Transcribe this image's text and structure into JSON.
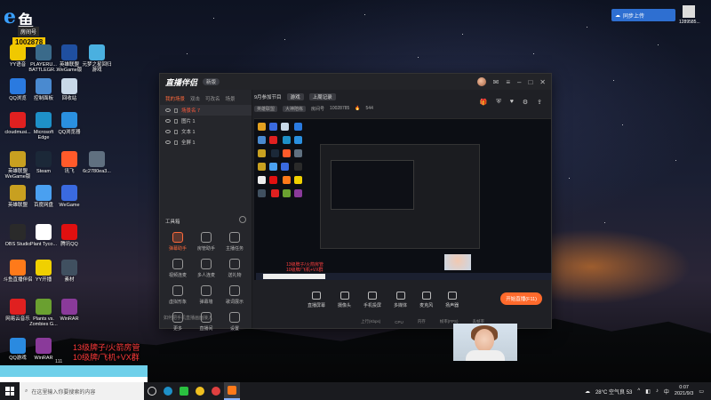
{
  "badge": {
    "room_label": "房间号",
    "room_number": "1002878"
  },
  "desktop_icons": [
    {
      "id": "yy",
      "label": "YY语音",
      "color": "#f0c800"
    },
    {
      "id": "playerunknown",
      "label": "PLAYERU... BATTLEGR...",
      "color": "#3a6a8a"
    },
    {
      "id": "lol-wegame",
      "label": "英雄联盟 WeGame版",
      "color": "#1f4fa0"
    },
    {
      "id": "yuanshen",
      "label": "元梦之星回归游戏",
      "color": "#4ab0e0"
    },
    {
      "id": "qq-browser",
      "label": "QQ浏览",
      "color": "#2a7ae0"
    },
    {
      "id": "control-panel",
      "label": "控制面板",
      "color": "#4a8ad0"
    },
    {
      "id": "recycle",
      "label": "回收站",
      "color": "#c8d8e8"
    },
    {
      "id": "cloudmusic",
      "label": "cloudmusi...",
      "color": "#e02020"
    },
    {
      "id": "edge",
      "label": "Microsoft Edge",
      "color": "#1e90c8"
    },
    {
      "id": "qqbrowser2",
      "label": "QQ浏览器",
      "color": "#2a90e0"
    },
    {
      "id": "lol-wegame2",
      "label": "英雄联盟 WeGame版",
      "color": "#c8a020"
    },
    {
      "id": "steam",
      "label": "Steam",
      "color": "#1b2838"
    },
    {
      "id": "xundong",
      "label": "讯飞",
      "color": "#ff5a2a"
    },
    {
      "id": "file-6c",
      "label": "6c2780ea3...",
      "color": "#607080"
    },
    {
      "id": "lol",
      "label": "英雄联盟",
      "color": "#c8a020"
    },
    {
      "id": "baidunet",
      "label": "百度网盘",
      "color": "#4aa0f0"
    },
    {
      "id": "wegame",
      "label": "WeGame",
      "color": "#3a6ae0"
    },
    {
      "id": "obs",
      "label": "OBS Studio",
      "color": "#2a2a2a"
    },
    {
      "id": "plants",
      "label": "Plant Tyco...",
      "color": "#ffffff"
    },
    {
      "id": "tencentqq",
      "label": "腾讯QQ",
      "color": "#e01010"
    },
    {
      "id": "douyu",
      "label": "斗鱼直播伴侣",
      "color": "#ff7a1a"
    },
    {
      "id": "yykaibo",
      "label": "YY开播",
      "color": "#f0d000"
    },
    {
      "id": "misc",
      "label": "素材",
      "color": "#405060"
    },
    {
      "id": "netease",
      "label": "网易云音乐",
      "color": "#e02020"
    },
    {
      "id": "pvz",
      "label": "Plants vs. Zombies G...",
      "color": "#6aa030"
    },
    {
      "id": "winrar",
      "label": "WinRAR",
      "color": "#8a3a9a"
    },
    {
      "id": "qqgame",
      "label": "QQ游戏",
      "color": "#2a8ae0"
    },
    {
      "id": "winrar2",
      "label": "WinRAR",
      "color": "#8a3a9a"
    }
  ],
  "top_right": {
    "widget": "同步上传",
    "file_label": "1289585..."
  },
  "app": {
    "name": "直播伴侣",
    "version": "新版",
    "tabs": [
      "我的场景",
      "双击",
      "可改名",
      "场景"
    ],
    "scene_name": "场景名 7",
    "sources": [
      "图片 1",
      "文本 1",
      "全屏 1"
    ],
    "tools_title": "工具箱",
    "tools": [
      {
        "label": "弹幕助手",
        "hot": true
      },
      {
        "label": "房管助手",
        "hot": false
      },
      {
        "label": "主播任务",
        "hot": false
      },
      {
        "label": "视频连麦",
        "hot": false
      },
      {
        "label": "多人连麦",
        "hot": false
      },
      {
        "label": "送礼物",
        "hot": false
      },
      {
        "label": "虚拟形象",
        "hot": false
      },
      {
        "label": "弹幕墙",
        "hot": false
      },
      {
        "label": "歌词展示",
        "hot": false
      },
      {
        "label": "更多",
        "hot": false
      },
      {
        "label": "直播间",
        "hot": false
      },
      {
        "label": "设置",
        "hot": false
      }
    ],
    "footer": "如何把手机直播画面接入",
    "header": {
      "title": "9月参加节目",
      "category": "游戏",
      "action": "上周记录",
      "sub_tags": [
        "英雄联盟",
        "大神陪练"
      ],
      "room_label": "房间号",
      "room_no": "10028785",
      "heat": "544"
    },
    "bottom_buttons": [
      "直播屏幕",
      "摄像头",
      "手机投屏",
      "多媒体",
      "麦克风",
      "扬声器"
    ],
    "start_button": "开始直播(F11)",
    "status": [
      "上行(Kbps)",
      "CPU",
      "内存",
      "帧率(FPS)",
      "丢帧率"
    ]
  },
  "promo": {
    "line1": "13级牌子/火箭房管",
    "line2": "10级牌/飞机+VX群",
    "digits": "111"
  },
  "taskbar": {
    "search_placeholder": "在这里输入你要搜索的内容",
    "weather": "28°C 空气良 53",
    "time": "0:07",
    "date": "2021/9/3"
  }
}
